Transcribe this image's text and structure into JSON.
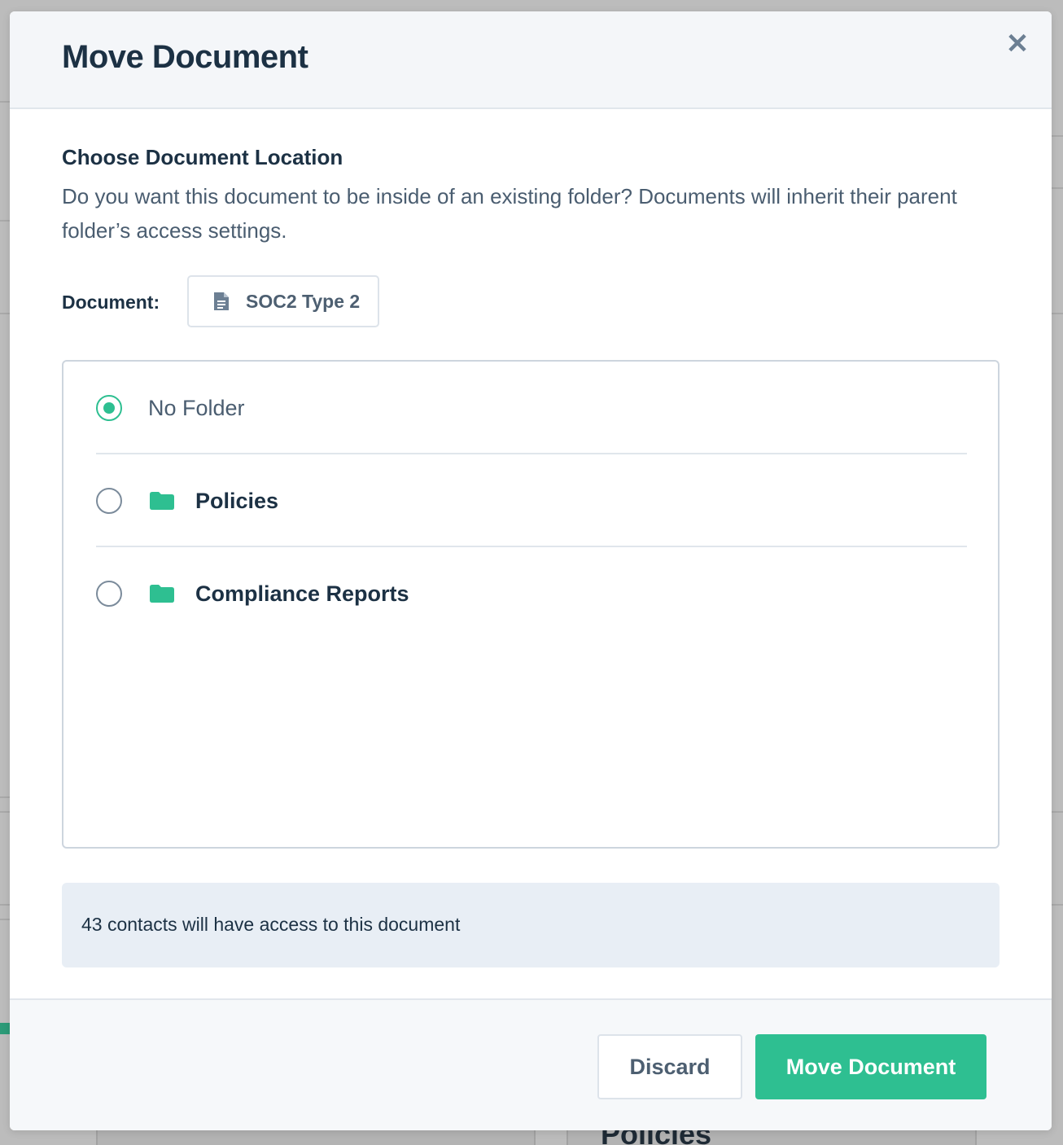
{
  "modal": {
    "title": "Move Document",
    "close_icon": "close-icon",
    "section_title": "Choose Document Location",
    "section_description": "Do you want this document to be inside of an existing folder? Documents will inherit their parent folder’s access settings.",
    "document_label": "Document:",
    "document_name": "SOC2 Type 2",
    "document_icon": "document-icon",
    "options": [
      {
        "label": "No Folder",
        "selected": true,
        "icon": null
      },
      {
        "label": "Policies",
        "selected": false,
        "icon": "folder-icon"
      },
      {
        "label": "Compliance Reports",
        "selected": false,
        "icon": "folder-icon"
      }
    ],
    "access_note": "43 contacts will have access to this document",
    "buttons": {
      "discard": "Discard",
      "move": "Move Document"
    }
  },
  "background": {
    "partial_heading": "Policies"
  },
  "colors": {
    "accent": "#2ebf91",
    "title": "#1c3144",
    "muted": "#4a5d70",
    "note_bg": "#e8eef5"
  }
}
